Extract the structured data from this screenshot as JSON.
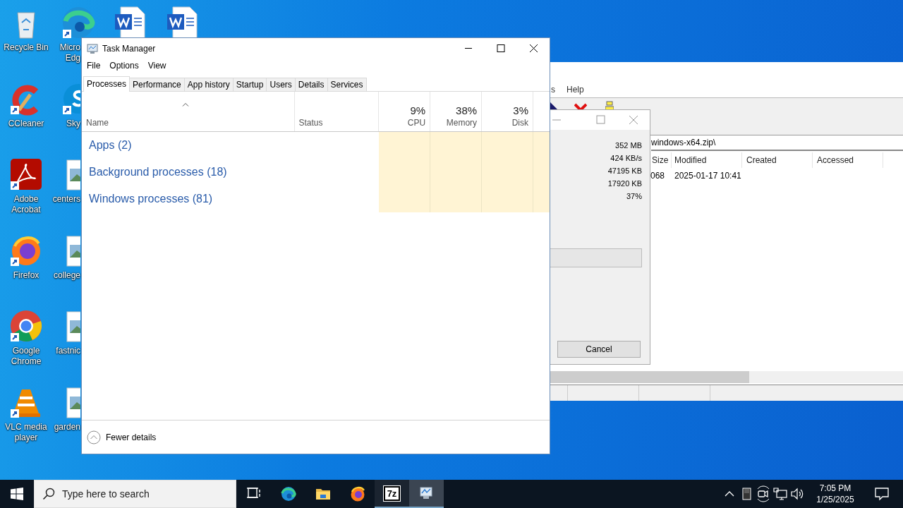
{
  "desktop": {
    "icons": [
      {
        "kind": "recycle",
        "label": "Recycle Bin"
      },
      {
        "kind": "ccleaner",
        "label": "CCleaner",
        "shortcut": true
      },
      {
        "kind": "acrobat",
        "label": "Adobe Acrobat",
        "shortcut": true
      },
      {
        "kind": "firefox",
        "label": "Firefox",
        "shortcut": true
      },
      {
        "kind": "chrome",
        "label": "Google Chrome",
        "shortcut": true
      },
      {
        "kind": "vlc",
        "label": "VLC media player",
        "shortcut": true
      },
      {
        "kind": "edge",
        "label": "Micro Edg",
        "shortcut": true
      },
      {
        "kind": "skype",
        "label": "Sky",
        "shortcut": true
      },
      {
        "kind": "image",
        "label": "centers"
      },
      {
        "kind": "image",
        "label": "college"
      },
      {
        "kind": "image",
        "label": "fastnic"
      },
      {
        "kind": "image",
        "label": "garden"
      },
      {
        "kind": "word"
      },
      {
        "kind": "word"
      }
    ]
  },
  "archive_window": {
    "menu": [
      "s",
      "Help"
    ],
    "address": "windows-x64.zip\\",
    "columns": [
      "Size",
      "Modified",
      "Created",
      "Accessed"
    ],
    "rows": [
      [
        "068",
        "2025-01-17 10:41"
      ]
    ]
  },
  "progress_dialog": {
    "values": [
      "352 MB",
      "424 KB/s",
      "47195 KB",
      "17920 KB",
      "37%"
    ],
    "cancel": "Cancel"
  },
  "task_manager": {
    "title": "Task Manager",
    "menu": [
      "File",
      "Options",
      "View"
    ],
    "tabs": [
      {
        "label": "Processes",
        "selected": true
      },
      {
        "label": "Performance",
        "selected": false
      },
      {
        "label": "App history",
        "selected": false
      },
      {
        "label": "Startup",
        "selected": false
      },
      {
        "label": "Users",
        "selected": false
      },
      {
        "label": "Details",
        "selected": false
      },
      {
        "label": "Services",
        "selected": false
      }
    ],
    "columns": [
      {
        "name": "Name"
      },
      {
        "name": "Status"
      },
      {
        "name": "CPU",
        "total": "9%"
      },
      {
        "name": "Memory",
        "total": "38%"
      },
      {
        "name": "Disk",
        "total": "3%"
      }
    ],
    "groups": [
      "Apps (2)",
      "Background processes (18)",
      "Windows processes (81)"
    ],
    "footer": "Fewer details"
  },
  "taskbar": {
    "search_placeholder": "Type here to search",
    "apps": [
      {
        "kind": "taskview",
        "running": false,
        "focused": false
      },
      {
        "kind": "edge",
        "running": false,
        "focused": false
      },
      {
        "kind": "explorer",
        "running": false,
        "focused": false
      },
      {
        "kind": "firefox",
        "running": false,
        "focused": false
      },
      {
        "kind": "sevenzip",
        "text": "7z",
        "running": true,
        "focused": false
      },
      {
        "kind": "taskmanager",
        "running": true,
        "focused": true
      }
    ],
    "time": "7:05 PM",
    "date": "1/25/2025"
  }
}
